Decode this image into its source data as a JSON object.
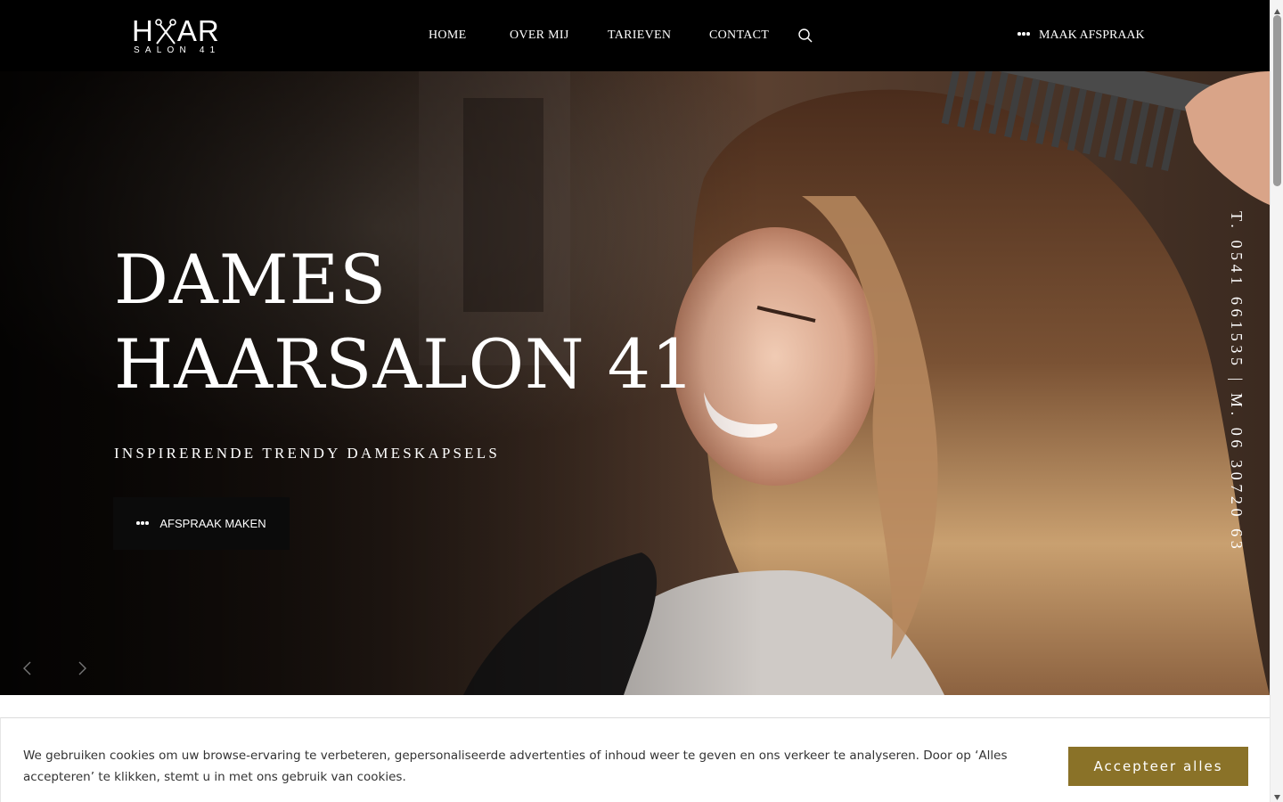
{
  "logo": {
    "wordmark": "HAAR",
    "sub": "SALON 41"
  },
  "nav": {
    "items": [
      {
        "label": "HOME"
      },
      {
        "label": "OVER MIJ"
      },
      {
        "label": "TARIEVEN"
      },
      {
        "label": "CONTACT"
      }
    ],
    "search_icon": "search-icon",
    "cta_label": "MAAK AFSPRAAK"
  },
  "hero": {
    "title_line1": "DAMES",
    "title_line2": "HAARSALON 41",
    "subtitle": "INSPIRERENDE TRENDY DAMESKAPSELS",
    "button_label": "AFSPRAAK MAKEN",
    "phone_text": "T. 0541 661535 | M. 06 30720 63",
    "prev_icon": "chevron-left-icon",
    "next_icon": "chevron-right-icon"
  },
  "cookie": {
    "text": "We gebruiken cookies om uw browse-ervaring te verbeteren, gepersonaliseerde advertenties of inhoud weer te geven en ons verkeer te analyseren. Door op ‘Alles accepteren’ te klikken, stemt u in met ons gebruik van cookies.",
    "accept_label": "Accepteer alles"
  },
  "colors": {
    "header_bg": "#000000",
    "accent_gold": "#8a7228",
    "text_white": "#ffffff"
  }
}
